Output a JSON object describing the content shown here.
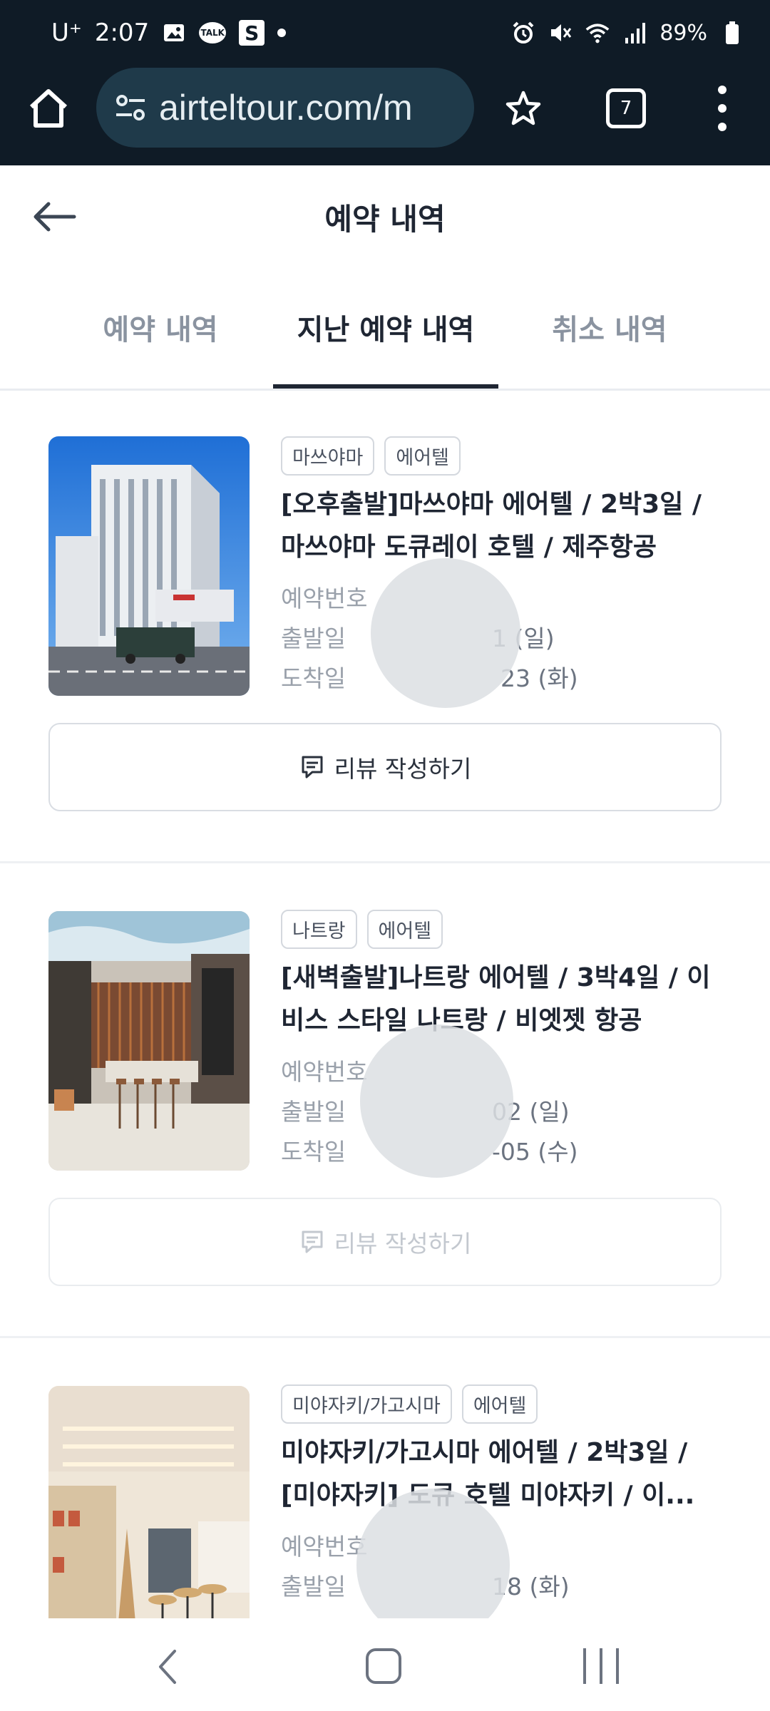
{
  "status_bar": {
    "carrier": "U⁺",
    "time": "2:07",
    "battery": "89%"
  },
  "browser": {
    "url": "airteltour.com/m",
    "tab_count": "7"
  },
  "header": {
    "title": "예약 내역"
  },
  "tabs": [
    {
      "label": "예약 내역",
      "active": false
    },
    {
      "label": "지난 예약 내역",
      "active": true
    },
    {
      "label": "취소 내역",
      "active": false
    }
  ],
  "bookings": [
    {
      "tags": [
        "마쓰야마",
        "에어텔"
      ],
      "title": "[오후출발]마쓰야마 에어텔 / 2박3일 / 마쓰야마 도큐레이 호텔 / 제주항공",
      "reservation_label": "예약번호",
      "depart_label": "출발일",
      "depart_value": "1 (일)",
      "arrive_label": "도착일",
      "arrive_value": "23 (화)",
      "review_label": "리뷰 작성하기",
      "review_enabled": true
    },
    {
      "tags": [
        "나트랑",
        "에어텔"
      ],
      "title": "[새벽출발]나트랑 에어텔 / 3박4일 / 이비스 스타일 나트랑 / 비엣젯 항공",
      "reservation_label": "예약번호",
      "depart_label": "출발일",
      "depart_value": "02 (일)",
      "arrive_label": "도착일",
      "arrive_value": "-05 (수)",
      "review_label": "리뷰 작성하기",
      "review_enabled": false
    },
    {
      "tags": [
        "미야자키/가고시마",
        "에어텔"
      ],
      "title": "미야자키/가고시마 에어텔 / 2박3일 / [미야자키] 도큐 호텔 미야자키 / 이...",
      "reservation_label": "예약번호",
      "depart_label": "출발일",
      "depart_value": "18 (화)"
    }
  ]
}
